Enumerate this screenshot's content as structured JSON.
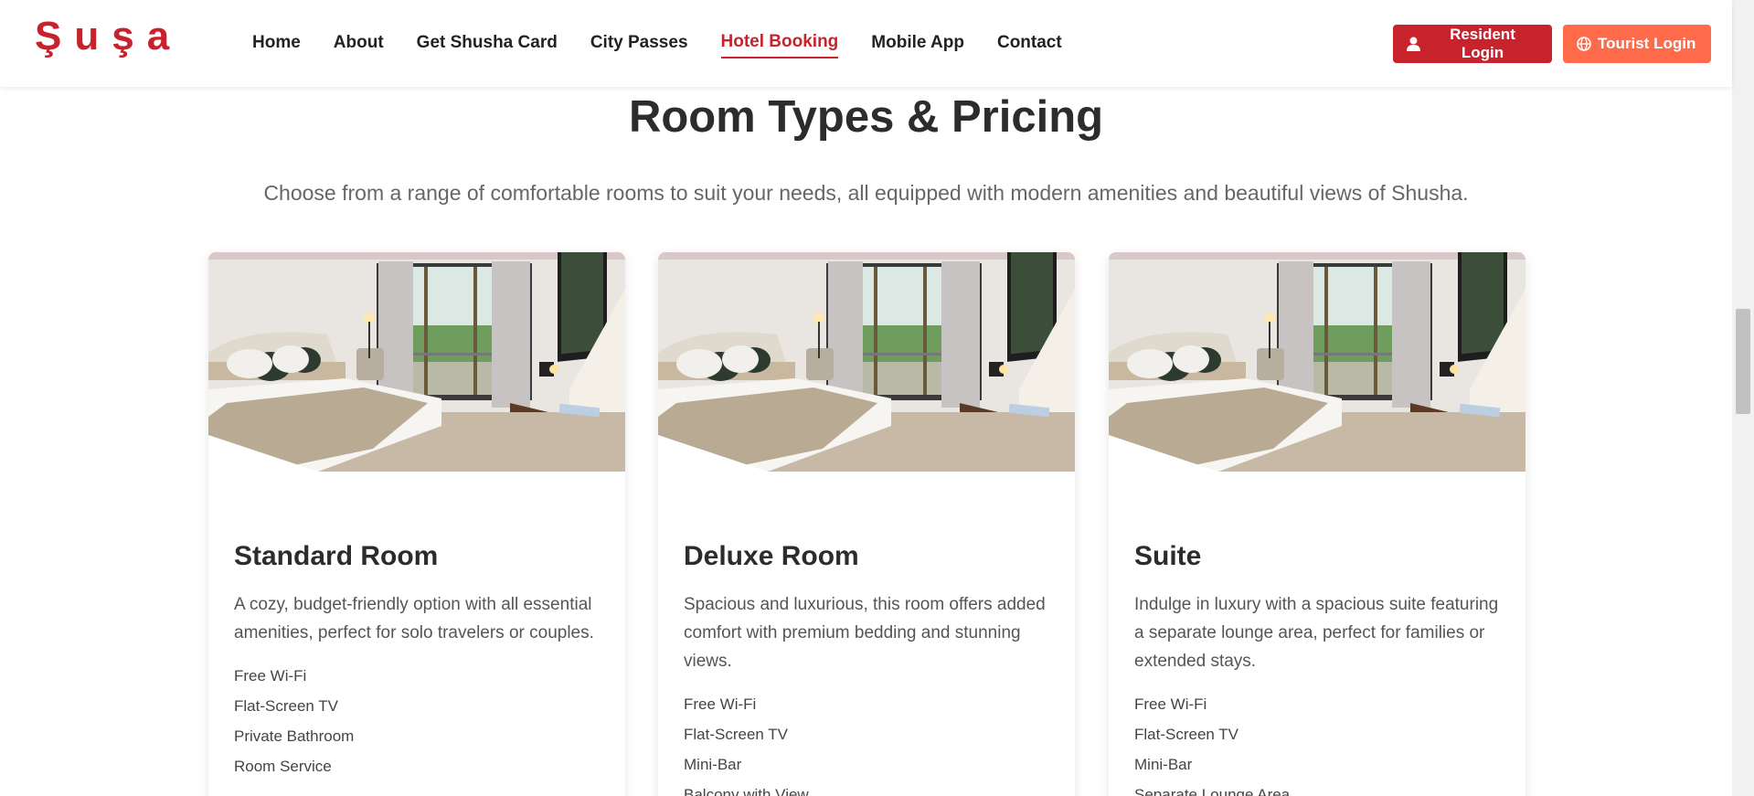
{
  "brand": {
    "logo_text": "Şuşa",
    "accent": "#c8222c",
    "tourist_color": "#ff6b4a"
  },
  "nav": {
    "items": [
      {
        "label": "Home"
      },
      {
        "label": "About"
      },
      {
        "label": "Get Shusha Card"
      },
      {
        "label": "City Passes"
      },
      {
        "label": "Hotel Booking",
        "active": true
      },
      {
        "label": "Mobile App"
      },
      {
        "label": "Contact"
      }
    ]
  },
  "auth": {
    "resident_label": "Resident Login",
    "resident_icon": "user-icon",
    "tourist_label": "Tourist Login",
    "tourist_icon": "globe-icon"
  },
  "section": {
    "title": "Room Types & Pricing",
    "subtitle": "Choose from a range of comfortable rooms to suit your needs, all equipped with modern amenities and beautiful views of Shusha."
  },
  "rooms": [
    {
      "title": "Standard Room",
      "description": "A cozy, budget-friendly option with all essential amenities, perfect for solo travelers or couples.",
      "features": [
        "Free Wi-Fi",
        "Flat-Screen TV",
        "Private Bathroom",
        "Room Service"
      ]
    },
    {
      "title": "Deluxe Room",
      "description": "Spacious and luxurious, this room offers added comfort with premium bedding and stunning views.",
      "features": [
        "Free Wi-Fi",
        "Flat-Screen TV",
        "Mini-Bar",
        "Balcony with View"
      ]
    },
    {
      "title": "Suite",
      "description": "Indulge in luxury with a spacious suite featuring a separate lounge area, perfect for families or extended stays.",
      "features": [
        "Free Wi-Fi",
        "Flat-Screen TV",
        "Mini-Bar",
        "Separate Lounge Area"
      ]
    }
  ]
}
